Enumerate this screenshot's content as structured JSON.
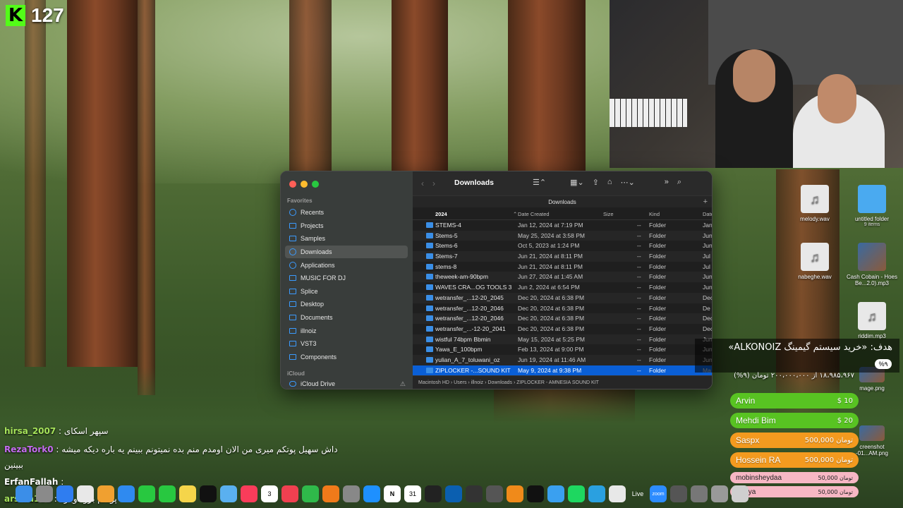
{
  "stream": {
    "viewer_count": "127",
    "logo": "K"
  },
  "finder": {
    "title": "Downloads",
    "path_header": "Downloads",
    "sidebar": {
      "favorites_label": "Favorites",
      "icloud_label": "iCloud",
      "items": [
        {
          "label": "Recents",
          "icon": "clock-icon"
        },
        {
          "label": "Projects",
          "icon": "folder-icon"
        },
        {
          "label": "Samples",
          "icon": "folder-icon"
        },
        {
          "label": "Downloads",
          "icon": "download-icon",
          "active": true
        },
        {
          "label": "Applications",
          "icon": "applications-icon"
        },
        {
          "label": "MUSIC FOR DJ",
          "icon": "folder-icon"
        },
        {
          "label": "Splice",
          "icon": "folder-icon"
        },
        {
          "label": "Desktop",
          "icon": "desktop-icon"
        },
        {
          "label": "Documents",
          "icon": "document-icon"
        },
        {
          "label": "illnoiz",
          "icon": "home-icon"
        },
        {
          "label": "VST3",
          "icon": "folder-icon"
        },
        {
          "label": "Components",
          "icon": "folder-icon"
        }
      ],
      "icloud_drive": "iCloud Drive"
    },
    "columns": {
      "name": "2024",
      "date": "Date Created",
      "size": "Size",
      "kind": "Kind",
      "extra": "Date"
    },
    "rows": [
      {
        "name": "STEMS-4",
        "date": "Jan 12, 2024 at 7:19 PM",
        "size": "--",
        "kind": "Folder",
        "extra": "Jan"
      },
      {
        "name": "Stems-5",
        "date": "May 25, 2024 at 3:58 PM",
        "size": "--",
        "kind": "Folder",
        "extra": "Jun"
      },
      {
        "name": "Stems-6",
        "date": "Oct 5, 2023 at 1:24 PM",
        "size": "--",
        "kind": "Folder",
        "extra": "Jun"
      },
      {
        "name": "Stems-7",
        "date": "Jun 21, 2024 at 8:11 PM",
        "size": "--",
        "kind": "Folder",
        "extra": "Jul"
      },
      {
        "name": "stems-8",
        "date": "Jun 21, 2024 at 8:11 PM",
        "size": "--",
        "kind": "Folder",
        "extra": "Jul"
      },
      {
        "name": "theweek-am-90bpm",
        "date": "Jun 27, 2024 at 1:45 AM",
        "size": "--",
        "kind": "Folder",
        "extra": "Jun"
      },
      {
        "name": "WAVES CRA...OG TOOLS 3",
        "date": "Jun 2, 2024 at 6:54 PM",
        "size": "--",
        "kind": "Folder",
        "extra": "Jun"
      },
      {
        "name": "wetransfer_...12-20_2045",
        "date": "Dec 20, 2024 at 6:38 PM",
        "size": "--",
        "kind": "Folder",
        "extra": "Dec"
      },
      {
        "name": "wetransfer_...12-20_2046",
        "date": "Dec 20, 2024 at 6:38 PM",
        "size": "--",
        "kind": "Folder",
        "extra": "De"
      },
      {
        "name": "wetransfer_...12-20_2046",
        "date": "Dec 20, 2024 at 6:38 PM",
        "size": "--",
        "kind": "Folder",
        "extra": "Dec"
      },
      {
        "name": "wetransfer_...-12-20_2041",
        "date": "Dec 20, 2024 at 6:38 PM",
        "size": "--",
        "kind": "Folder",
        "extra": "Dec"
      },
      {
        "name": "wistful 74bpm Bbmin",
        "date": "May 15, 2024 at 5:25 PM",
        "size": "--",
        "kind": "Folder",
        "extra": "Jun"
      },
      {
        "name": "Yawa_E_100bpm",
        "date": "Feb 13, 2024 at 9:00 PM",
        "size": "--",
        "kind": "Folder",
        "extra": "Jun"
      },
      {
        "name": "yulian_A_7_toluwani_oz",
        "date": "Jun 19, 2024 at 11:46 AM",
        "size": "--",
        "kind": "Folder",
        "extra": "Jun"
      },
      {
        "name": "ZIPLOCKER -...SOUND KIT",
        "date": "May 9, 2024 at 9:38 PM",
        "size": "--",
        "kind": "Folder",
        "extra": "Ma",
        "selected": true
      }
    ],
    "statusbar": "Macintosh HD › Users › illnoiz › Downloads › ZIPLOCKER - AMNESIA SOUND KIT"
  },
  "desktop_icons": [
    {
      "label": "melody.wav",
      "sub": "",
      "type": "audio"
    },
    {
      "label": "untitled folder",
      "sub": "9 items",
      "type": "folder"
    },
    {
      "label": "nabeghe.wav",
      "sub": "",
      "type": "audio"
    },
    {
      "label": "Cash Cobain - Hoes Be...2.0).mp3",
      "sub": "",
      "type": "photo"
    },
    {
      "label": "riddim.mp3",
      "sub": "",
      "type": "audio"
    },
    {
      "label": "mage.png",
      "sub": "",
      "type": "photo"
    },
    {
      "label": "creenshot -01...AM.png",
      "sub": "",
      "type": "photo"
    }
  ],
  "goal": {
    "title": "هدف: «خرید سیستم گیمینگ ALKONOIZ»",
    "amount": "۱۸،۹۸۵،۹۶۷ از ۲۰۰،۰۰۰،۰۰۰ تومان (۹%)",
    "percent": "%۹",
    "progress_fraction": 0.09
  },
  "donations": [
    {
      "name": "Arvin",
      "amount": "$ 10",
      "color": "#58c322"
    },
    {
      "name": "Mehdi Bim",
      "amount": "$ 20",
      "color": "#58c322"
    },
    {
      "name": "Saspx",
      "amount": "500,000 تومان",
      "color": "#f39a1f"
    },
    {
      "name": "Hossein RA",
      "amount": "500,000 تومان",
      "color": "#f39a1f"
    },
    {
      "name": "mobinsheydaa",
      "amount": "50,000 تومان",
      "color": "#f7b7c4"
    },
    {
      "name": "Poriya",
      "amount": "50,000 تومان",
      "color": "#f7b7c4"
    }
  ],
  "chat": [
    {
      "user": "hirsa_2007",
      "sep": " : ",
      "text": "سپهر اسکای",
      "color": "#a6e35a"
    },
    {
      "user": "RezaTork0",
      "sep": " : ",
      "text": "داش سهیل پوتکم میری من الان اومدم منم بده نمیتونم ببینم یه باره دیکه میشه",
      "color": "#c56cf0"
    },
    {
      "user": "",
      "sep": "",
      "text": "ببینین",
      "color": "#ffffff"
    },
    {
      "user": "ErfanFallah",
      "sep": " : ",
      "text": "",
      "color": "#ffffff"
    },
    {
      "user": "arshia111",
      "sep": " : ",
      "text": "پوتکم برو دوباره",
      "color": "#a6e35a"
    }
  ],
  "dock": {
    "apps": [
      "finder-icon",
      "launchpad-icon",
      "safari-icon",
      "chrome-icon",
      "photos-icon",
      "mail-icon",
      "facetime-icon",
      "messages-icon",
      "notes-icon",
      "appletv-icon",
      "folder-icon",
      "music-icon",
      "calendar-icon",
      "news-icon",
      "numbers-icon",
      "pages-icon",
      "settings-icon",
      "appstore-icon",
      "notion-icon",
      "calendar31-icon",
      "maschine-icon",
      "waves-icon",
      "unity-icon",
      "logic-icon",
      "fl-studio-icon",
      "capcut-icon",
      "files-icon",
      "spotify-icon",
      "telegram-icon",
      "pen-icon",
      "live-icon",
      "zoom-icon",
      "other-icon",
      "other2-icon",
      "other3-icon",
      "trash-icon"
    ],
    "live_label": "Live",
    "zoom_label": "zoom",
    "calendar_day": "3",
    "calendar31": "31",
    "notion_letter": "N"
  }
}
